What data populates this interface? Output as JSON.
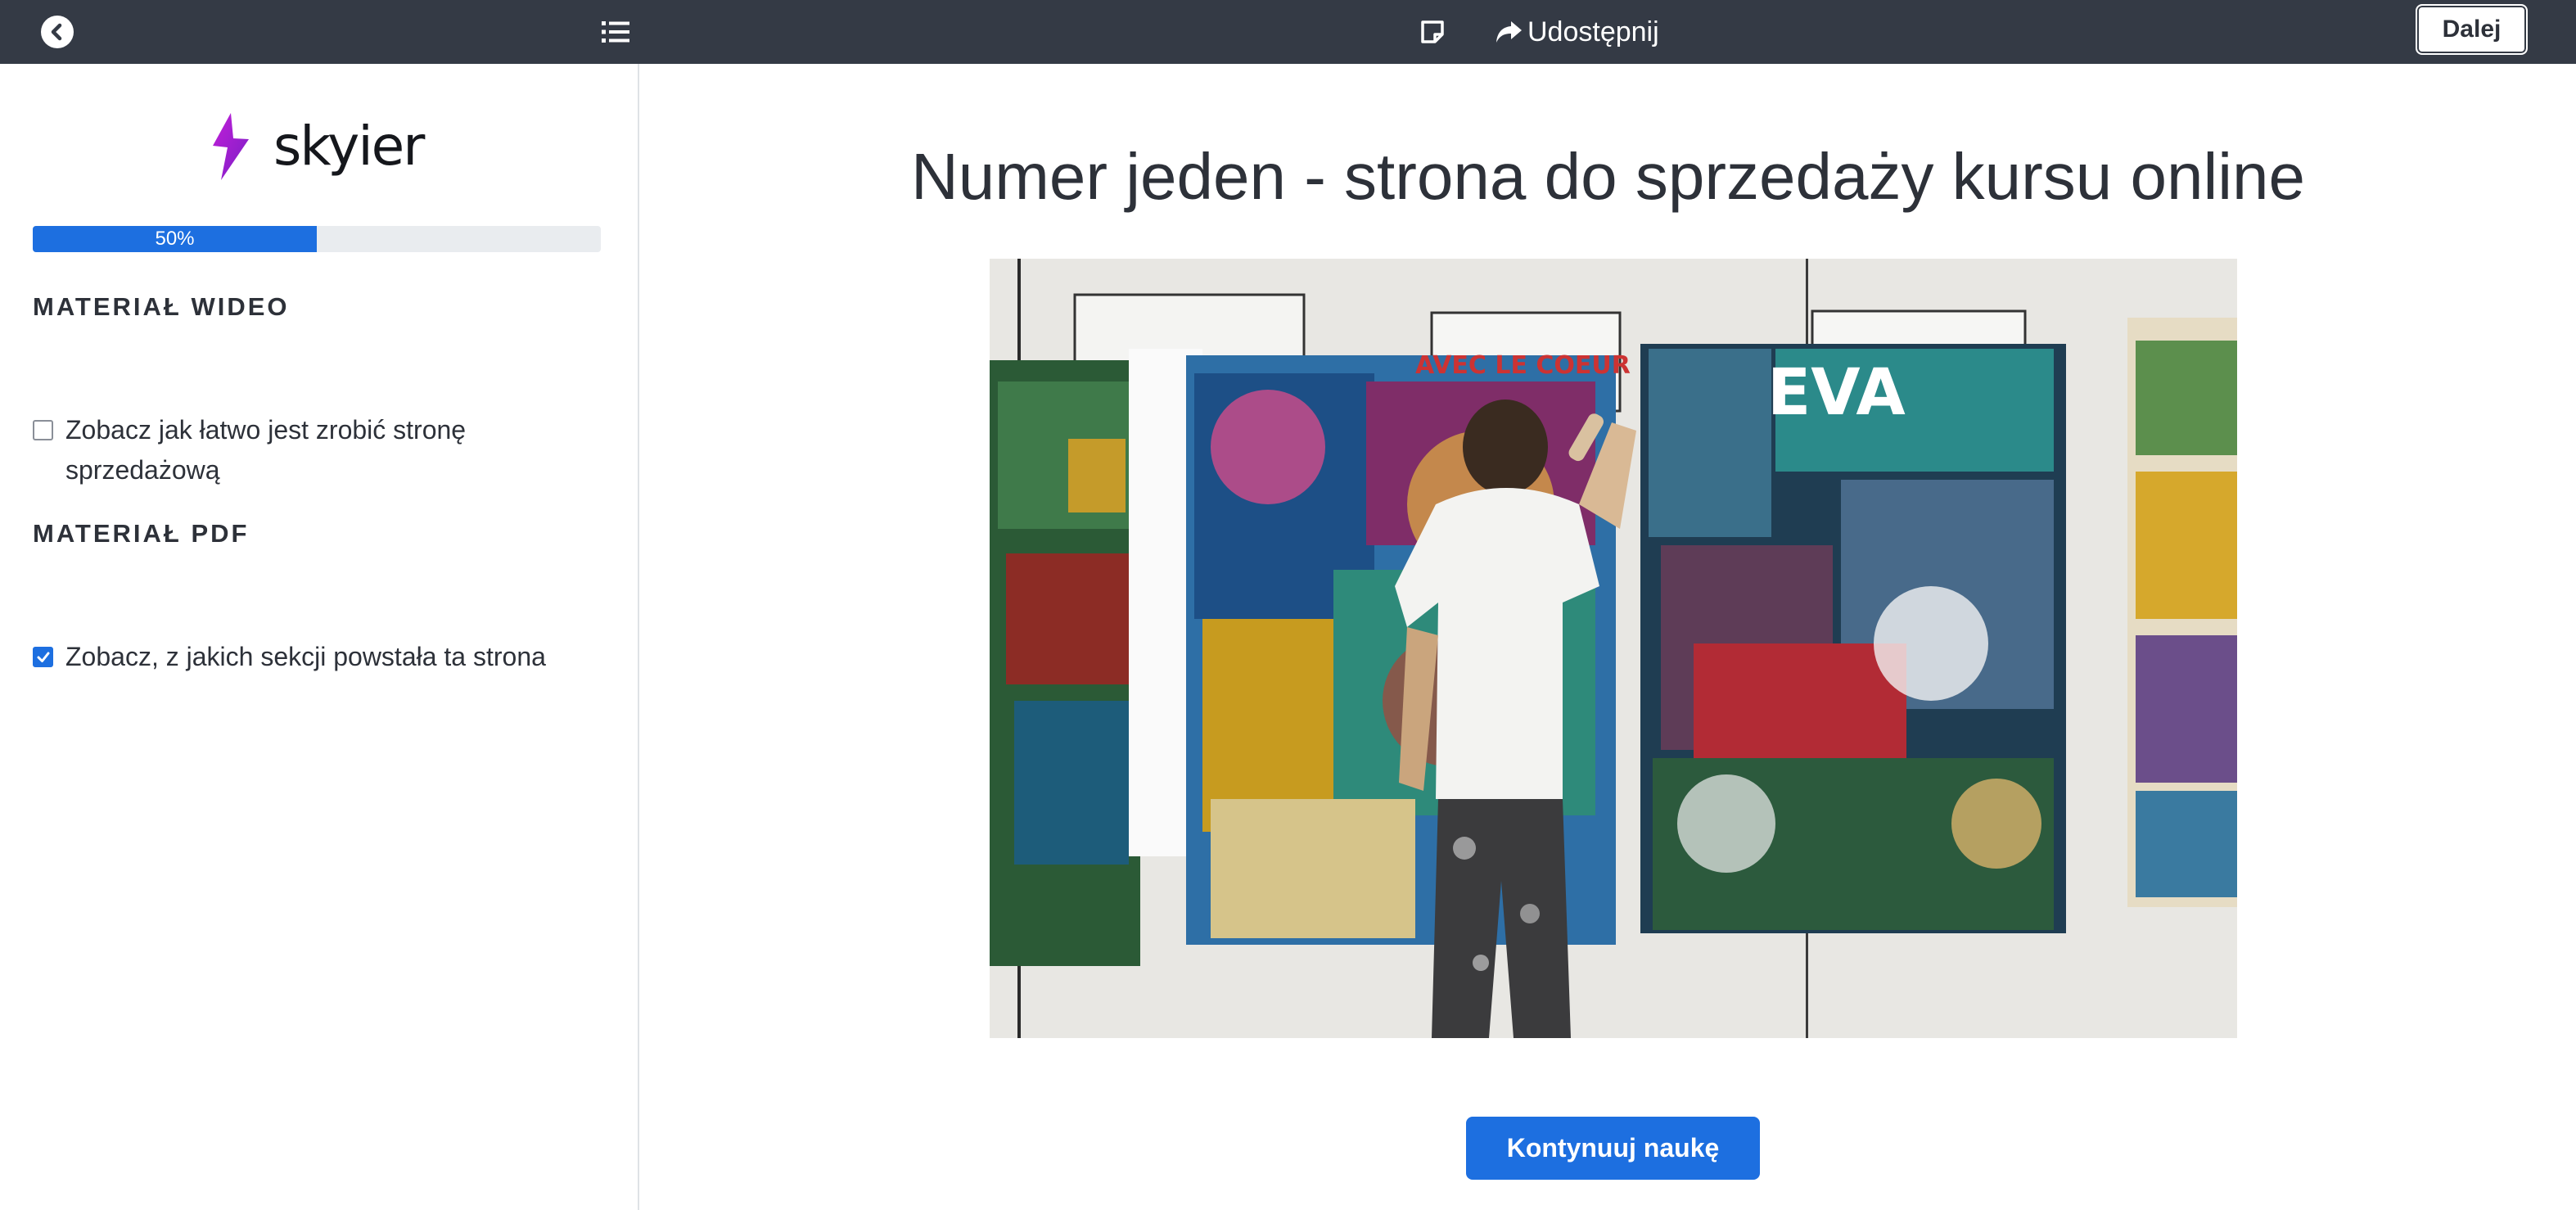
{
  "topbar": {
    "back_icon": "chevron-left-circle-icon",
    "list_icon": "list-icon",
    "note_icon": "note-icon",
    "share_icon": "share-arrow-icon",
    "share_label": "Udostępnij",
    "next_label": "Dalej"
  },
  "sidebar": {
    "logo_text": "skyier",
    "progress": {
      "percent": 50,
      "label": "50%"
    },
    "sections": [
      {
        "title": "MATERIAŁ WIDEO",
        "lessons": [
          {
            "label": "Zobacz jak łatwo jest zrobić stronę sprzedażową",
            "checked": false
          }
        ]
      },
      {
        "title": "MATERIAŁ PDF",
        "lessons": [
          {
            "label": "Zobacz, z jakich sekcji powstała ta strona",
            "checked": true
          }
        ]
      }
    ]
  },
  "main": {
    "title": "Numer jeden - strona do sprzedaży kursu online",
    "image_description_icon": "artist-painting-mural-image",
    "continue_label": "Kontynuuj naukę"
  },
  "colors": {
    "topbar": "#343a45",
    "accent": "#1d6fe0",
    "logo_bolt": "#9b1fd1"
  }
}
